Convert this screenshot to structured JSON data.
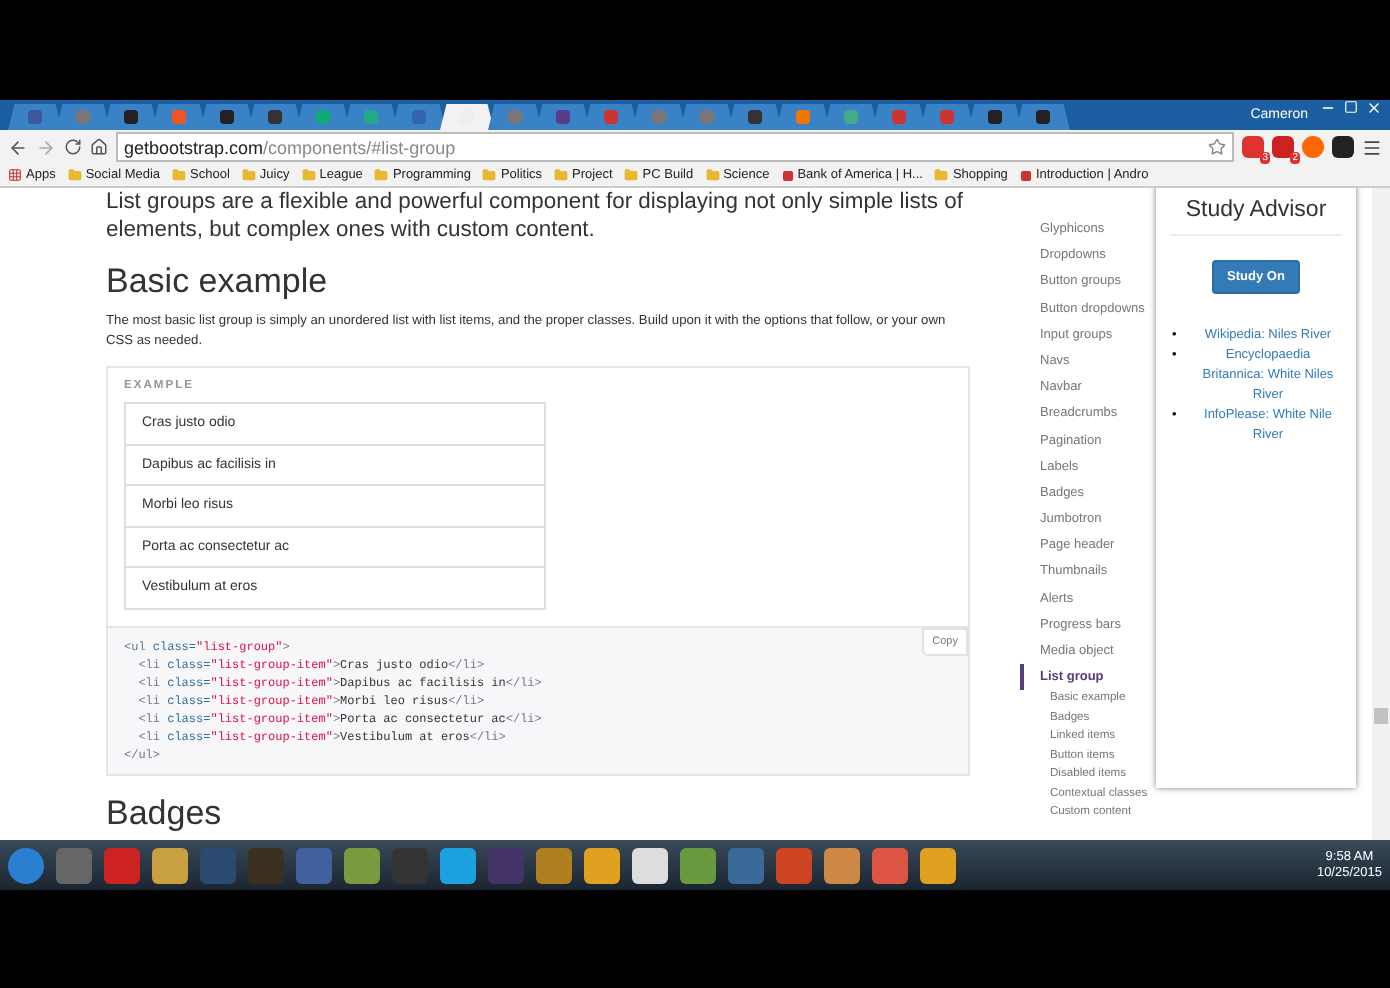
{
  "window": {
    "user": "Cameron"
  },
  "tabs": [
    {
      "selected": false
    },
    {
      "selected": false
    },
    {
      "selected": false
    },
    {
      "selected": false
    },
    {
      "selected": false
    },
    {
      "selected": false
    },
    {
      "selected": false
    },
    {
      "selected": false
    },
    {
      "selected": false
    },
    {
      "selected": true
    },
    {
      "selected": false
    },
    {
      "selected": false
    },
    {
      "selected": false
    },
    {
      "selected": false
    },
    {
      "selected": false
    },
    {
      "selected": false
    },
    {
      "selected": false
    },
    {
      "selected": false
    },
    {
      "selected": false
    },
    {
      "selected": false
    },
    {
      "selected": false
    },
    {
      "selected": false
    }
  ],
  "address": {
    "host": "getbootstrap.com",
    "path": "/components/#list-group"
  },
  "extensions": [
    {
      "badge": "3"
    },
    {
      "badge": "2"
    }
  ],
  "bookmarks": [
    {
      "label": "Apps",
      "kind": "apps"
    },
    {
      "label": "Social Media",
      "kind": "folder"
    },
    {
      "label": "School",
      "kind": "folder"
    },
    {
      "label": "Juicy",
      "kind": "folder"
    },
    {
      "label": "League",
      "kind": "folder"
    },
    {
      "label": "Programming",
      "kind": "folder"
    },
    {
      "label": "Politics",
      "kind": "folder"
    },
    {
      "label": "Project",
      "kind": "folder"
    },
    {
      "label": "PC Build",
      "kind": "folder"
    },
    {
      "label": "Science",
      "kind": "folder"
    },
    {
      "label": "Bank of America | H...",
      "kind": "site"
    },
    {
      "label": "Shopping",
      "kind": "folder"
    },
    {
      "label": "Introduction | Andro",
      "kind": "site"
    }
  ],
  "content": {
    "intro": [
      "List groups are a flexible and powerful component for displaying not only simple lists of",
      "elements, but complex ones with custom content."
    ],
    "heading": "Basic example",
    "paragraph": "The most basic list group is simply an unordered list with list items, and the proper classes. Build upon it with the options that follow, or your own CSS as needed.",
    "example_label": "EXAMPLE",
    "list_items": [
      "Cras justo odio",
      "Dapibus ac facilisis in",
      "Morbi leo risus",
      "Porta ac consectetur ac",
      "Vestibulum at eros"
    ],
    "copy_button": "Copy",
    "code": [
      [
        {
          "t": "<ul ",
          "kind": "tag"
        },
        {
          "t": "class=",
          "kind": "attr"
        },
        {
          "t": "\"list-group\"",
          "kind": "str"
        },
        {
          "t": ">",
          "kind": "tag"
        }
      ],
      [
        {
          "t": "  <li ",
          "kind": "tag"
        },
        {
          "t": "class=",
          "kind": "attr"
        },
        {
          "t": "\"list-group-item\"",
          "kind": "str"
        },
        {
          "t": ">",
          "kind": "tag"
        },
        {
          "t": "Cras justo odio",
          "kind": "plain"
        },
        {
          "t": "</li>",
          "kind": "tag"
        }
      ],
      [
        {
          "t": "  <li ",
          "kind": "tag"
        },
        {
          "t": "class=",
          "kind": "attr"
        },
        {
          "t": "\"list-group-item\"",
          "kind": "str"
        },
        {
          "t": ">",
          "kind": "tag"
        },
        {
          "t": "Dapibus ac facilisis in",
          "kind": "plain"
        },
        {
          "t": "</li>",
          "kind": "tag"
        }
      ],
      [
        {
          "t": "  <li ",
          "kind": "tag"
        },
        {
          "t": "class=",
          "kind": "attr"
        },
        {
          "t": "\"list-group-item\"",
          "kind": "str"
        },
        {
          "t": ">",
          "kind": "tag"
        },
        {
          "t": "Morbi leo risus",
          "kind": "plain"
        },
        {
          "t": "</li>",
          "kind": "tag"
        }
      ],
      [
        {
          "t": "  <li ",
          "kind": "tag"
        },
        {
          "t": "class=",
          "kind": "attr"
        },
        {
          "t": "\"list-group-item\"",
          "kind": "str"
        },
        {
          "t": ">",
          "kind": "tag"
        },
        {
          "t": "Porta ac consectetur ac",
          "kind": "plain"
        },
        {
          "t": "</li>",
          "kind": "tag"
        }
      ],
      [
        {
          "t": "  <li ",
          "kind": "tag"
        },
        {
          "t": "class=",
          "kind": "attr"
        },
        {
          "t": "\"list-group-item\"",
          "kind": "str"
        },
        {
          "t": ">",
          "kind": "tag"
        },
        {
          "t": "Vestibulum at eros",
          "kind": "plain"
        },
        {
          "t": "</li>",
          "kind": "tag"
        }
      ],
      [
        {
          "t": "</ul>",
          "kind": "tag"
        }
      ]
    ],
    "next_heading": "Badges"
  },
  "sidebar": {
    "items": [
      {
        "label": "Glyphicons",
        "selected": false
      },
      {
        "label": "Dropdowns",
        "selected": false
      },
      {
        "label": "Button groups",
        "selected": false
      },
      {
        "label": "Button dropdowns",
        "selected": false
      },
      {
        "label": "Input groups",
        "selected": false
      },
      {
        "label": "Navs",
        "selected": false
      },
      {
        "label": "Navbar",
        "selected": false
      },
      {
        "label": "Breadcrumbs",
        "selected": false
      },
      {
        "label": "Pagination",
        "selected": false
      },
      {
        "label": "Labels",
        "selected": false
      },
      {
        "label": "Badges",
        "selected": false
      },
      {
        "label": "Jumbotron",
        "selected": false
      },
      {
        "label": "Page header",
        "selected": false
      },
      {
        "label": "Thumbnails",
        "selected": false
      },
      {
        "label": "Alerts",
        "selected": false
      },
      {
        "label": "Progress bars",
        "selected": false
      },
      {
        "label": "Media object",
        "selected": false
      },
      {
        "label": "List group",
        "selected": true,
        "children": [
          {
            "label": "Basic example"
          },
          {
            "label": "Badges"
          },
          {
            "label": "Linked items"
          },
          {
            "label": "Button items"
          },
          {
            "label": "Disabled items"
          },
          {
            "label": "Contextual classes"
          },
          {
            "label": "Custom content"
          }
        ]
      }
    ]
  },
  "popup": {
    "title": "Study Advisor",
    "button": "Study On",
    "links": [
      {
        "marker": "•",
        "text": "Wikipedia: Niles River"
      },
      {
        "marker": "•",
        "text": "Encyclopaedia Britannica: White Niles River"
      },
      {
        "marker": "•",
        "text": "InfoPlease: White Nile River"
      }
    ]
  },
  "taskbar": {
    "time": "9:58 AM",
    "date": "10/25/2015"
  }
}
